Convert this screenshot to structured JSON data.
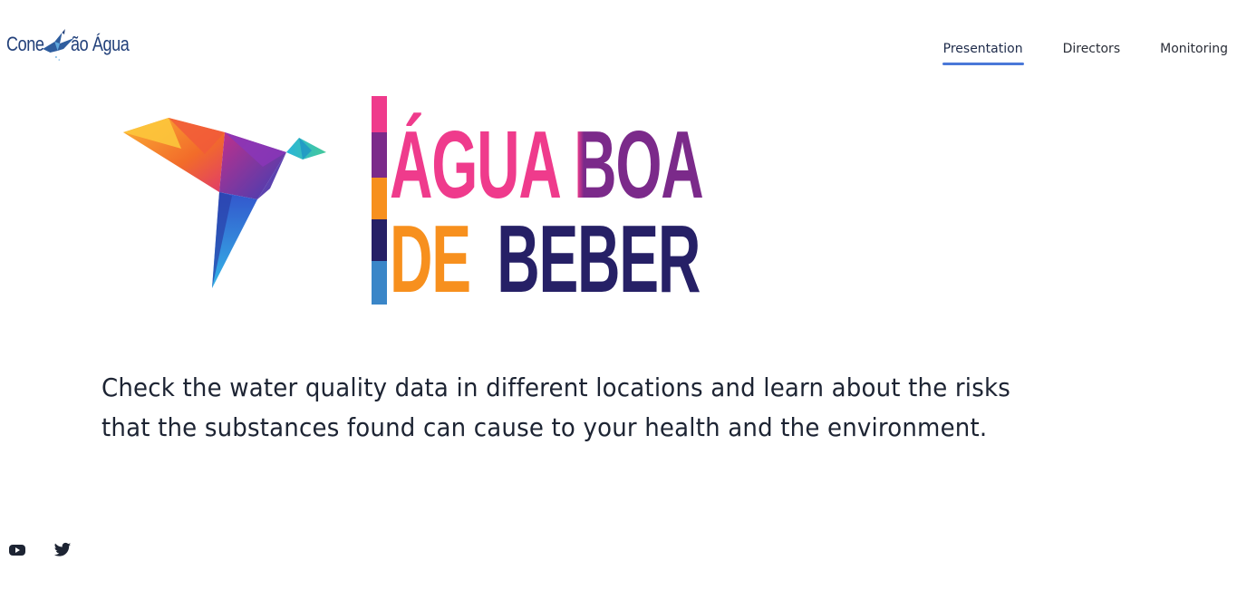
{
  "header": {
    "logo_text_before": "Cone",
    "logo_text_after": "ão Água"
  },
  "nav": {
    "items": [
      {
        "label": "Presentation",
        "active": true
      },
      {
        "label": "Directors",
        "active": false
      },
      {
        "label": "Monitoring",
        "active": false
      }
    ]
  },
  "hero": {
    "title_line1": "ÁGUA BOA",
    "title_line2_part1": "DE",
    "title_line2_part2": "BEBER",
    "colors": {
      "pink": "#ef3b8c",
      "purple": "#7b2a8a",
      "orange": "#f7901e",
      "navy": "#262066",
      "blue": "#3a86c8"
    }
  },
  "tagline": "Check the water quality data in different locations and learn about the risks that the substances found can cause to your health and the environment.",
  "social": {
    "icons": [
      "youtube-icon",
      "twitter-icon"
    ]
  }
}
